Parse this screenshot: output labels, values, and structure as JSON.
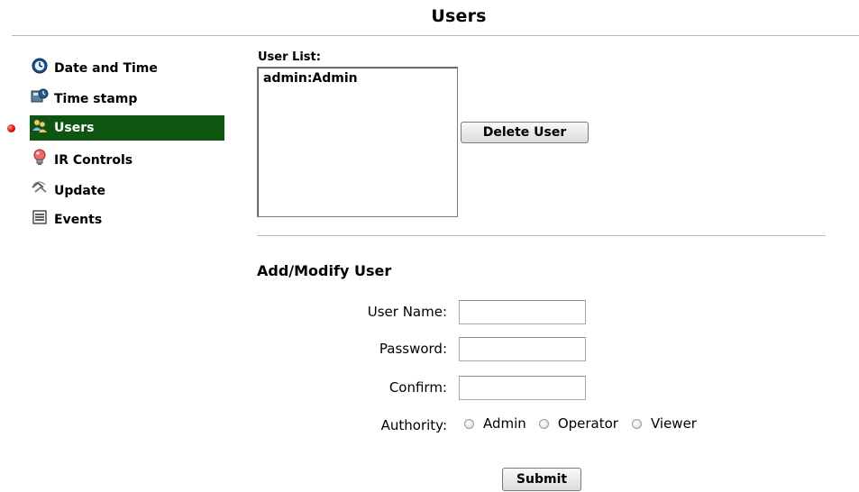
{
  "page": {
    "title": "Users"
  },
  "sidebar": {
    "items": [
      {
        "label": "Date and Time",
        "icon": "clock-icon",
        "active": false
      },
      {
        "label": "Time stamp",
        "icon": "timestamp-icon",
        "active": false
      },
      {
        "label": "Users",
        "icon": "users-icon",
        "active": true
      },
      {
        "label": "IR Controls",
        "icon": "bulb-icon",
        "active": false
      },
      {
        "label": "Update",
        "icon": "update-icon",
        "active": false
      },
      {
        "label": "Events",
        "icon": "list-icon",
        "active": false
      }
    ],
    "active_color": "#0e5512"
  },
  "user_list": {
    "label": "User List:",
    "options": [
      "admin:Admin"
    ],
    "delete_label": "Delete User"
  },
  "form": {
    "title": "Add/Modify User",
    "username_label": "User Name:",
    "username_value": "",
    "password_label": "Password:",
    "password_value": "",
    "confirm_label": "Confirm:",
    "confirm_value": "",
    "authority_label": "Authority:",
    "authority_options": [
      "Admin",
      "Operator",
      "Viewer"
    ],
    "authority_selected": null,
    "submit_label": "Submit"
  }
}
